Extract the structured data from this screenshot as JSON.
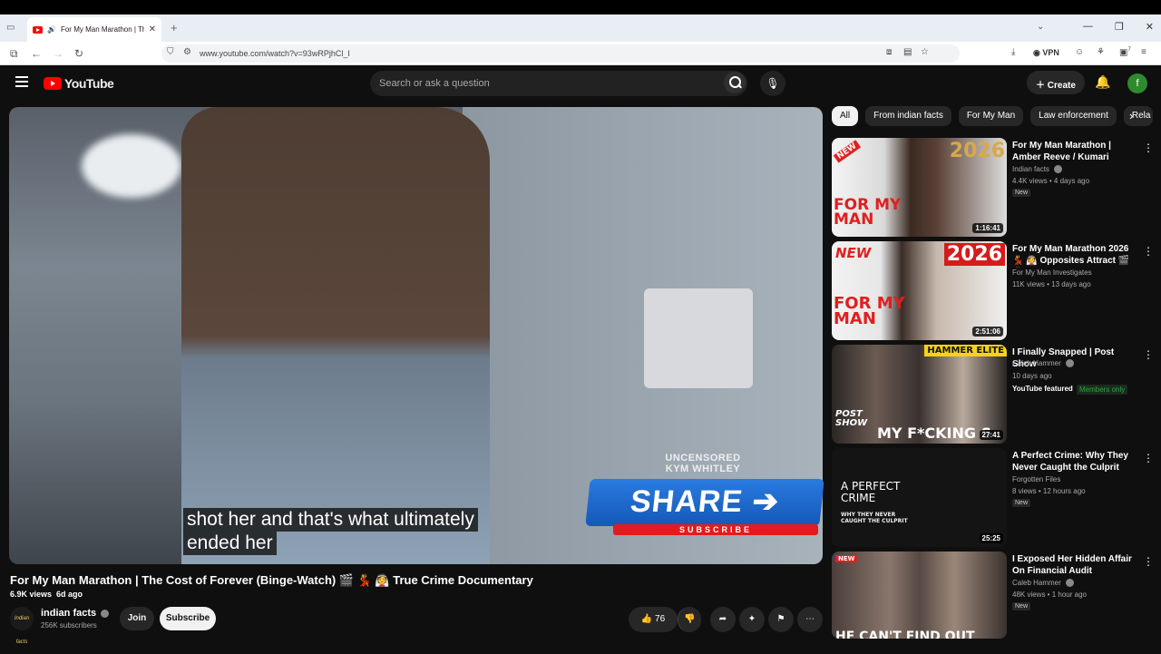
{
  "browser": {
    "tab_title": "For My Man Marathon | The Cost of Forever (Binge-Watch)",
    "url": "www.youtube.com/watch?v=93wRPjhCl_I",
    "vpn_label": "VPN",
    "ext_badge": "7"
  },
  "header": {
    "logo_text": "YouTube",
    "search_placeholder": "Search or ask a question",
    "create_label": "Create",
    "avatar_letter": "f"
  },
  "player": {
    "caption_line1": "shot her and that's what ultimately",
    "caption_line2": "ended her",
    "overlay_small1": "UNCENSORED",
    "overlay_small2": "KYM WHITLEY",
    "share_text": "SHARE",
    "subscribe_bar_text": "SUBSCRIBE"
  },
  "video": {
    "title": "For My Man Marathon | The Cost of Forever (Binge-Watch) 🎬 💃 👰 True Crime Documentary",
    "views": "6.9K views",
    "age": "6d ago",
    "channel_name": "indian facts",
    "channel_avatar_text": "Indian facts",
    "subscribers": "256K subscribers",
    "join_label": "Join",
    "subscribe_label": "Subscribe",
    "like_count": "76"
  },
  "chips": [
    "All",
    "From indian facts",
    "For My Man",
    "Law enforcement",
    "Rela"
  ],
  "recommendations": [
    {
      "title": "For My Man Marathon | Amber Reeve / Kumari Fulbright (Binge...",
      "channel": "Indian facts",
      "meta": "4.4K views • 4 days ago",
      "badge": "New",
      "duration": "1:16:41",
      "thumb_text_top": "2026",
      "thumb_text_main": "FOR MY MAN",
      "thumb_corner": "NEW"
    },
    {
      "title": "For My Man Marathon 2026 💃 👰 Opposites Attract 🎬 💃 ...",
      "channel": "For My Man Investigates",
      "meta": "11K views • 13 days ago",
      "duration": "2:51:06",
      "thumb_text_top": "2026",
      "thumb_text_main": "FOR MY MAN",
      "thumb_corner": "NEW"
    },
    {
      "title": "I Finally Snapped | Post Show",
      "channel": "Caleb Hammer",
      "meta": "10 days ago",
      "featured": "YouTube featured",
      "members": "Members only",
      "duration": "27:41",
      "thumb_text_top": "HAMMER ELITE",
      "thumb_text_main": "MY F*CKING S",
      "thumb_corner": "POST SHOW"
    },
    {
      "title": "A Perfect Crime: Why They Never Caught the Culprit",
      "channel": "Forgotten Files",
      "meta": "8 views • 12 hours ago",
      "badge": "New",
      "duration": "25:25",
      "thumb_text_top": "A PERFECT CRIME",
      "thumb_text_main": "WHY THEY NEVER CAUGHT THE CULPRIT"
    },
    {
      "title": "I Exposed Her Hidden Affair On Financial Audit",
      "channel": "Caleb Hammer",
      "meta": "48K views • 1 hour ago",
      "badge": "New",
      "thumb_corner": "NEW",
      "thumb_text_main": "HE CAN'T FIND OUT"
    }
  ]
}
